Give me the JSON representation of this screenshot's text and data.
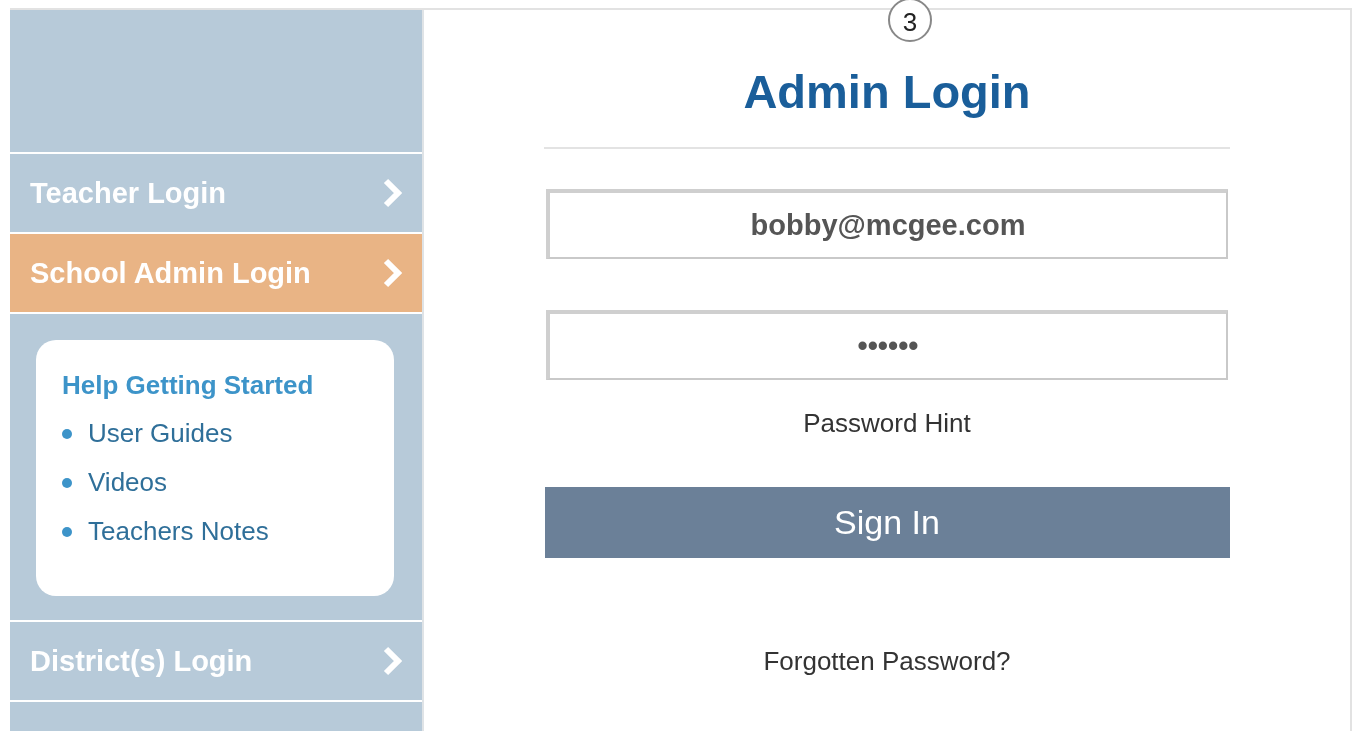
{
  "step_badge": "3",
  "sidebar": {
    "items": [
      {
        "label": "Teacher Login",
        "selected": false
      },
      {
        "label": "School Admin Login",
        "selected": true
      },
      {
        "label": "District(s) Login",
        "selected": false
      }
    ],
    "help": {
      "title": "Help Getting Started",
      "links": [
        "User Guides",
        "Videos",
        "Teachers Notes"
      ]
    }
  },
  "login": {
    "title": "Admin Login",
    "email": "bobby@mcgee.com",
    "password": "••••••",
    "hint_link": "Password Hint",
    "submit": "Sign In",
    "forgot_link": "Forgotten Password?"
  }
}
